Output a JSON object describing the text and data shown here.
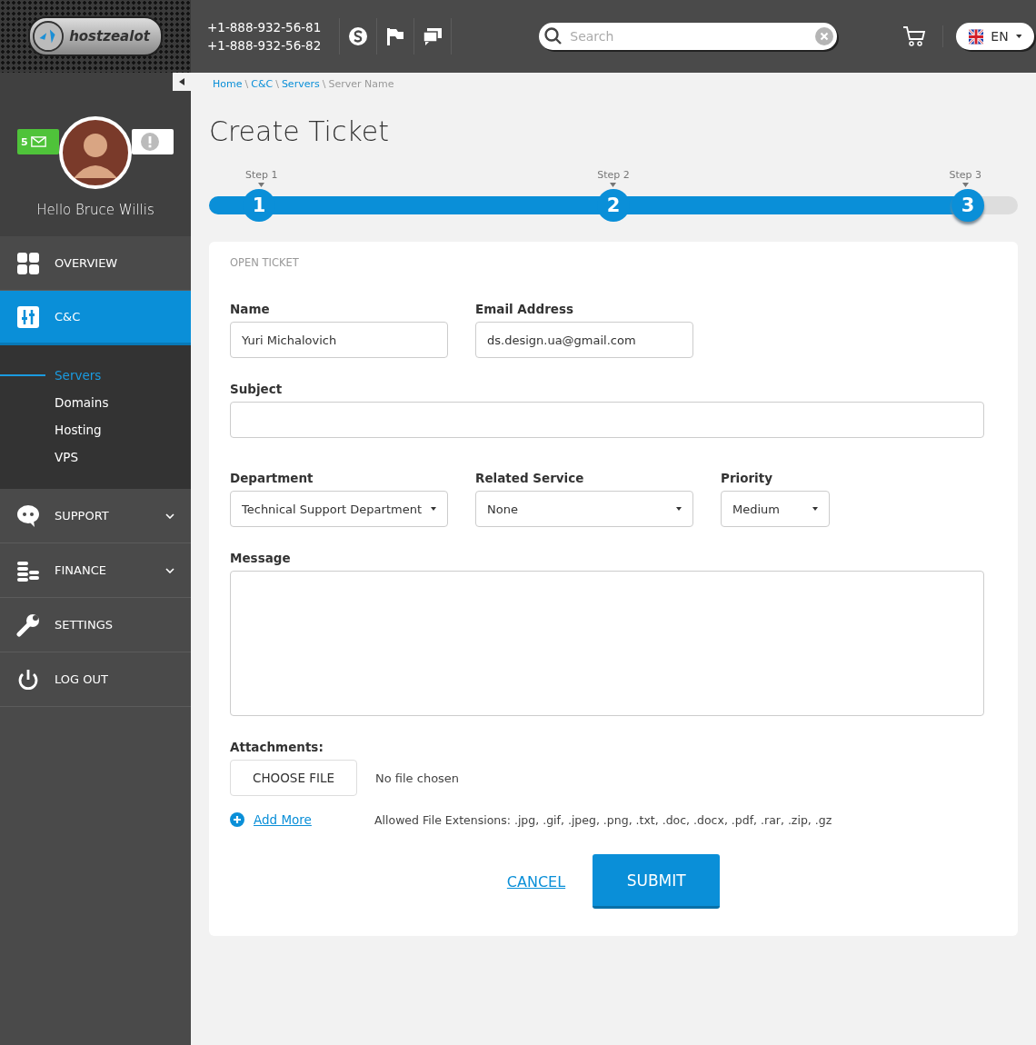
{
  "header": {
    "logo": "hostzealot",
    "phones": [
      "+1-888-932-56-81",
      "+1-888-932-56-82"
    ],
    "search": {
      "placeholder": "Search"
    },
    "language": "EN"
  },
  "user": {
    "greeting": "Hello",
    "name": "Bruce Willis",
    "unread_messages": "5"
  },
  "sidebar": {
    "items": [
      {
        "label": "OVERVIEW",
        "selected": false,
        "has_submenu": false
      },
      {
        "label": "C&C",
        "selected": true,
        "has_submenu": false,
        "children": [
          {
            "label": "Servers",
            "selected": true
          },
          {
            "label": "Domains",
            "selected": false
          },
          {
            "label": "Hosting",
            "selected": false
          },
          {
            "label": "VPS",
            "selected": false
          }
        ]
      },
      {
        "label": "SUPPORT",
        "selected": false,
        "has_submenu": true
      },
      {
        "label": "FINANCE",
        "selected": false,
        "has_submenu": true
      },
      {
        "label": "SETTINGS",
        "selected": false,
        "has_submenu": false
      },
      {
        "label": "LOG OUT",
        "selected": false,
        "has_submenu": false
      }
    ]
  },
  "breadcrumb": {
    "separator": "\\",
    "items": [
      {
        "label": "Home",
        "link": true
      },
      {
        "label": "C&C",
        "link": true
      },
      {
        "label": "Servers",
        "link": true
      },
      {
        "label": "Server Name",
        "link": false
      }
    ]
  },
  "title": "Create Ticket",
  "steps": {
    "level": 0.94,
    "items": [
      {
        "label": "Step 1",
        "number": "1",
        "current": false
      },
      {
        "label": "Step 2",
        "number": "2",
        "current": false
      },
      {
        "label": "Step 3",
        "number": "3",
        "current": true
      }
    ]
  },
  "form": {
    "section": "OPEN TICKET",
    "name": {
      "label": "Name",
      "value": "Yuri Michalovich"
    },
    "email": {
      "label": "Email Address",
      "value": "ds.design.ua@gmail.com"
    },
    "subject": {
      "label": "Subject"
    },
    "department": {
      "label": "Department",
      "value": "Technical Support Department"
    },
    "related_service": {
      "label": "Related Service",
      "value": "None"
    },
    "priority": {
      "label": "Priority",
      "value": "Medium"
    },
    "message": {
      "label": "Message"
    },
    "attachments": {
      "label": "Attachments:",
      "button": "CHOOSE FILE",
      "status": "No file chosen",
      "add_more": "Add More",
      "allowed": "Allowed File Extensions: .jpg, .gif, .jpeg, .png, .txt, .doc, .docx, .pdf, .rar, .zip, .gz"
    },
    "buttons": {
      "cancel": "CANCEL",
      "submit": "SUBMIT"
    }
  }
}
